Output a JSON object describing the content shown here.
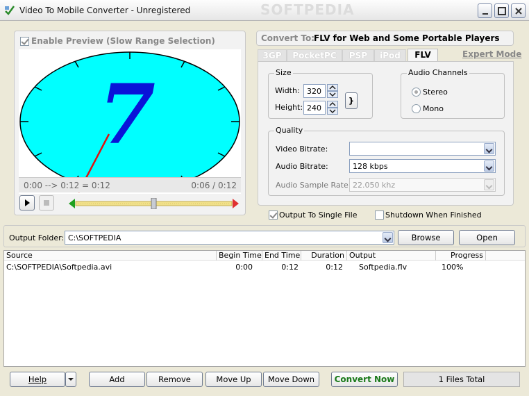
{
  "window": {
    "title": "Video To Mobile Converter - Unregistered",
    "watermark": "SOFTPEDIA"
  },
  "preview": {
    "enable_label": "Enable Preview (Slow Range Selection)",
    "enabled": true,
    "clock_digit": "7",
    "range_text": "0:00 --> 0:12 = 0:12",
    "position_text": "0:06 / 0:12",
    "slider_fraction": 0.5
  },
  "convert": {
    "label": "Convert To:",
    "target": "FLV for Web and Some Portable Players",
    "tabs": [
      "3GP",
      "PocketPC",
      "PSP",
      "iPod",
      "FLV"
    ],
    "active_tab": "FLV",
    "expert_mode": "Expert Mode"
  },
  "size": {
    "group_label": "Size",
    "width_label": "Width:",
    "width_value": "320",
    "height_label": "Height:",
    "height_value": "240",
    "link_symbol": "}"
  },
  "audio_channels": {
    "group_label": "Audio Channels",
    "options": [
      "Stereo",
      "Mono"
    ],
    "selected": "Stereo"
  },
  "quality": {
    "group_label": "Quality",
    "video_bitrate_label": "Video Bitrate:",
    "video_bitrate_value": "",
    "audio_bitrate_label": "Audio Bitrate:",
    "audio_bitrate_value": "128 kbps",
    "sample_rate_label": "Audio Sample Rate:",
    "sample_rate_value": "22.050 khz"
  },
  "options": {
    "single_file_label": "Output To Single File",
    "single_file_checked": true,
    "shutdown_label": "Shutdown When Finished",
    "shutdown_checked": false
  },
  "output": {
    "folder_label": "Output Folder:",
    "folder_value": "C:\\SOFTPEDIA",
    "browse": "Browse",
    "open": "Open"
  },
  "list": {
    "columns": [
      "Source",
      "Begin Time",
      "End Time",
      "Duration",
      "Output",
      "Progress"
    ],
    "rows": [
      [
        "C:\\SOFTPEDIA\\Softpedia.avi",
        "0:00",
        "0:12",
        "0:12",
        "Softpedia.flv",
        "100%"
      ]
    ]
  },
  "footer": {
    "help": "Help",
    "add": "Add",
    "remove": "Remove",
    "move_up": "Move Up",
    "move_down": "Move Down",
    "convert_now": "Convert Now",
    "status": "1 Files Total"
  },
  "colors": {
    "clock_face": "#00ffff",
    "digit": "#0a14d8",
    "hand": "#e01010",
    "convert_text": "#1a7a1a"
  }
}
